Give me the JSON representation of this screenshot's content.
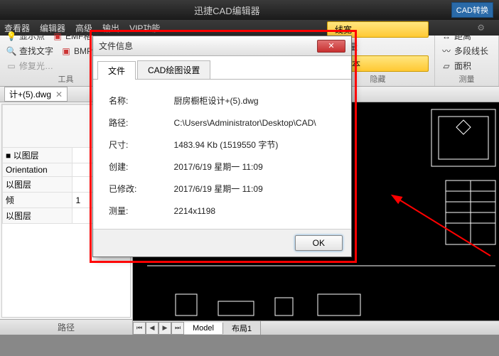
{
  "app": {
    "title": "迅捷CAD编辑器",
    "cad_convert": "CAD转换"
  },
  "menu": {
    "viewer": "查看器",
    "editor": "编辑器",
    "advanced": "高级",
    "output": "输出",
    "vip": "VIP功能"
  },
  "ribbon": {
    "g1": {
      "show_pts": "显示点",
      "emf": "EMF格式",
      "find_text": "查找文字",
      "bmp": "BMP格式",
      "fix": "修复光…",
      "label": "工具"
    },
    "g2": {
      "linewidth": "线宽",
      "distance": "距离",
      "measure": "测量",
      "polyline": "多段线长",
      "text": "文本",
      "area": "面积",
      "label": "隐藏",
      "label2": "测量"
    }
  },
  "doc": {
    "name": "计+(5).dwg"
  },
  "props": {
    "by_layer": "以图层",
    "orientation": "Orientation",
    "angle_label": "倾",
    "angle_val": "1",
    "footer": "路径"
  },
  "canvas_tabs": {
    "model": "Model",
    "layout1": "布局1"
  },
  "dialog": {
    "title": "文件信息",
    "tab_file": "文件",
    "tab_cad": "CAD绘图设置",
    "rows": {
      "name_l": "名称:",
      "name_v": "厨房橱柜设计+(5).dwg",
      "path_l": "路径:",
      "path_v": "C:\\Users\\Administrator\\Desktop\\CAD\\",
      "size_l": "尺寸:",
      "size_v": "1483.94 Kb (1519550 字节)",
      "created_l": "创建:",
      "created_v": "2017/6/19 星期一 11:09",
      "modified_l": "已修改:",
      "modified_v": "2017/6/19 星期一 11:09",
      "measure_l": "测量:",
      "measure_v": "2214x1198"
    },
    "ok": "OK"
  }
}
